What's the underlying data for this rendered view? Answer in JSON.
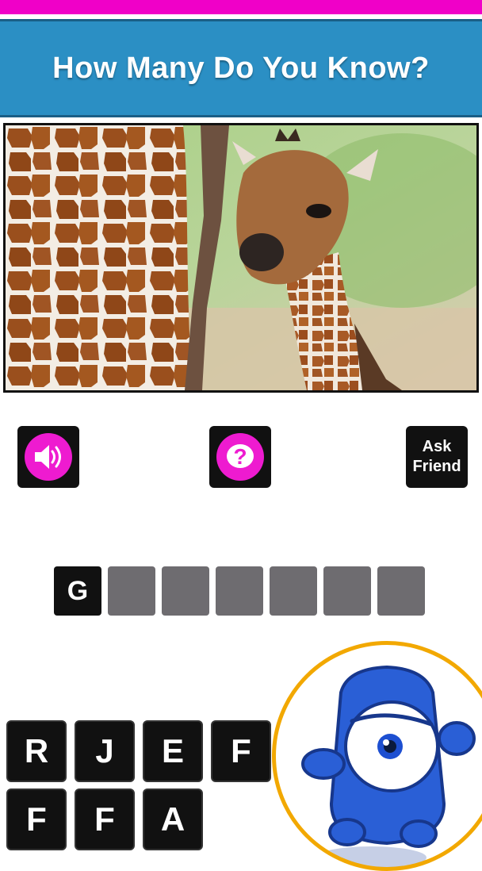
{
  "header": {
    "title": "How Many Do You Know?"
  },
  "photo": {
    "subject": "baby giraffe"
  },
  "actions": {
    "sound_icon": "speaker-icon",
    "hint_icon": "question-mark-icon",
    "ask_friend_line1": "Ask",
    "ask_friend_line2": "Friend"
  },
  "answer": {
    "letters": [
      "G",
      "",
      "",
      "",
      "",
      "",
      ""
    ]
  },
  "keyboard": {
    "row1": [
      "R",
      "J",
      "E",
      "F"
    ],
    "row2": [
      "F",
      "F",
      "A"
    ]
  },
  "colors": {
    "top_strip": "#f000c8",
    "header": "#2b8fc4",
    "accent_pink": "#ee1bd0",
    "slot_empty": "#6e6c70",
    "slot_filled": "#111111",
    "mascot_ring": "#f2a800",
    "mascot_body": "#2a5fd6"
  }
}
